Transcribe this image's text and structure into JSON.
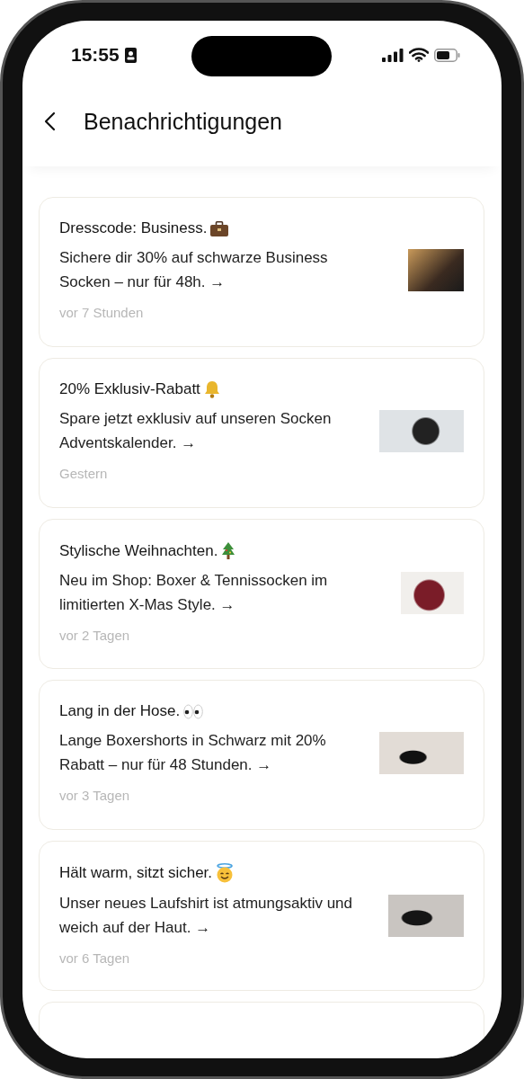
{
  "status_bar": {
    "time": "15:55"
  },
  "header": {
    "title": "Benachrichtigungen"
  },
  "notifications": [
    {
      "title": "Dresscode: Business.",
      "body": "Sichere dir 30% auf schwarze Business Socken – nur für 48h. →",
      "time": "vor 7 Stunden"
    },
    {
      "title": "20% Exklusiv-Rabatt",
      "body": "Spare jetzt exklusiv auf unseren Socken Adventskalender. →",
      "time": "Gestern"
    },
    {
      "title": "Stylische Weihnachten.",
      "body": "Neu im Shop: Boxer & Tennissocken im limitierten X-Mas Style. →",
      "time": "vor 2 Tagen"
    },
    {
      "title": "Lang in der Hose.",
      "body": "Lange Boxershorts in Schwarz mit 20% Rabatt – nur für 48 Stunden. →",
      "time": "vor 3 Tagen"
    },
    {
      "title": "Hält warm, sitzt sicher.",
      "body": "Unser neues Laufshirt ist atmungsaktiv und weich auf der Haut. →",
      "time": "vor 6 Tagen"
    }
  ]
}
